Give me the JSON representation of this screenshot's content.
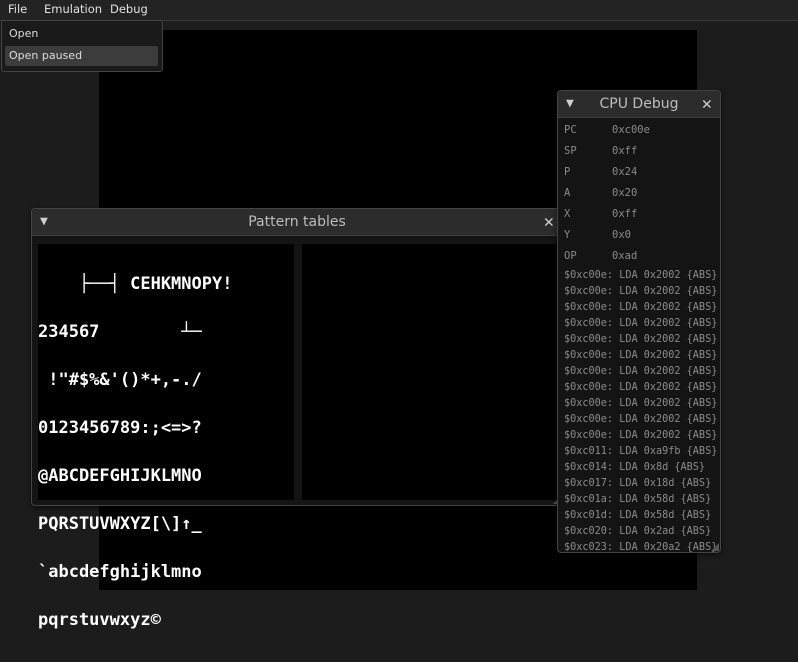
{
  "menu": {
    "file": "File",
    "emulation": "Emulation",
    "debug": "Debug"
  },
  "file_menu": {
    "open": "Open",
    "open_paused": "Open paused"
  },
  "pattern_tables": {
    "title": "Pattern tables",
    "collapse_icon": "▼",
    "close_icon": "✕",
    "rows": [
      "    ├──┤ CEHKMNOPY!",
      "234567        ┴─",
      " !\"#$%&'()*+,-./",
      "0123456789:;<=>?",
      "@ABCDEFGHIJKLMNO",
      "PQRSTUVWXYZ[\\]↑_",
      "`abcdefghijklmno",
      "pqrstuvwxyz©"
    ]
  },
  "cpu_debug": {
    "title": "CPU Debug",
    "collapse_icon": "▼",
    "close_icon": "✕",
    "registers": [
      {
        "name": "PC",
        "value": "0xc00e"
      },
      {
        "name": "SP",
        "value": "0xff"
      },
      {
        "name": "P",
        "value": "0x24"
      },
      {
        "name": "A",
        "value": "0x20"
      },
      {
        "name": "X",
        "value": "0xff"
      },
      {
        "name": "Y",
        "value": "0x0"
      },
      {
        "name": "OP",
        "value": "0xad"
      }
    ],
    "log": [
      "$0xc00e: LDA 0x2002 {ABS}",
      "$0xc00e: LDA 0x2002 {ABS}",
      "$0xc00e: LDA 0x2002 {ABS}",
      "$0xc00e: LDA 0x2002 {ABS}",
      "$0xc00e: LDA 0x2002 {ABS}",
      "$0xc00e: LDA 0x2002 {ABS}",
      "$0xc00e: LDA 0x2002 {ABS}",
      "$0xc00e: LDA 0x2002 {ABS}",
      "$0xc00e: LDA 0x2002 {ABS}",
      "$0xc00e: LDA 0x2002 {ABS}",
      "$0xc00e: LDA 0x2002 {ABS}",
      "$0xc011: LDA 0xa9fb {ABS}",
      "$0xc014: LDA 0x8d {ABS}",
      "$0xc017: LDA 0x18d {ABS}",
      "$0xc01a: LDA 0x58d {ABS}",
      "$0xc01d: LDA 0x58d {ABS}",
      "$0xc020: LDA 0x2ad {ABS}",
      "$0xc023: LDA 0x20a2 {ABS}"
    ]
  }
}
